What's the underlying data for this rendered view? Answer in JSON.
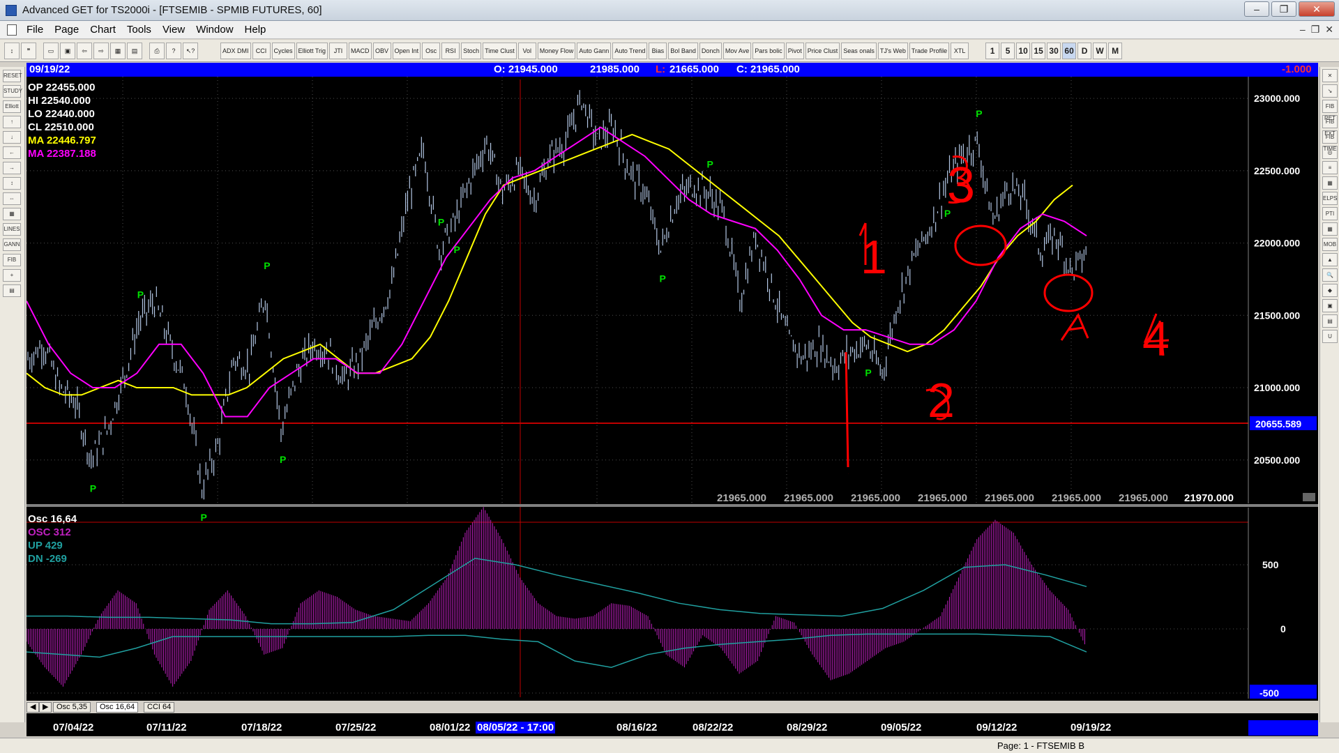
{
  "window": {
    "title": "Advanced GET for TS2000i - [FTSEMIB - SPMIB FUTURES, 60]",
    "minimize": "–",
    "maximize": "❐",
    "close": "✕"
  },
  "menu": [
    "File",
    "Page",
    "Chart",
    "Tools",
    "View",
    "Window",
    "Help"
  ],
  "toolbar": {
    "studies": [
      "ADX DMI",
      "CCI",
      "Cycles",
      "Elliott Trig",
      "JTI",
      "MACD",
      "OBV",
      "Open Int",
      "Osc",
      "RSI",
      "Stoch",
      "Time Clust",
      "Vol",
      "Money Flow",
      "Auto Gann",
      "Auto Trend",
      "Bias",
      "Bol Band",
      "Donch",
      "Mov Ave",
      "Pars bolic",
      "Pivot",
      "Price Clust",
      "Seas onals",
      "TJ's Web",
      "Trade Profile",
      "XTL"
    ],
    "intervals": [
      "1",
      "5",
      "10",
      "15",
      "30",
      "60",
      "D",
      "W",
      "M"
    ],
    "active_interval": "60"
  },
  "left_tools": [
    "RESET",
    "STUDY",
    "Elliott",
    "↑",
    "↓",
    "←",
    "→",
    "↕",
    "⇔",
    "▦",
    "LINES",
    "GANN",
    "FIB",
    "+",
    "▤"
  ],
  "right_tools": [
    "✕",
    "↘",
    "FIB RET",
    "FIB EXT",
    "FIB TIME",
    "◎",
    "≡",
    "▦",
    "ELPS",
    "PTI",
    "▦",
    "MOB",
    "▲",
    "🔍",
    "◆",
    "▣",
    "▤",
    "U"
  ],
  "infobar": {
    "date": "09/19/22",
    "open": "O: 21945.000",
    "high": "21985.000",
    "low_label": "L:",
    "low": "21665.000",
    "close": "C: 21965.000",
    "change": "-1.000"
  },
  "readout": {
    "op": "OP  22455.000",
    "hi": "HI   22540.000",
    "lo": "LO   22440.000",
    "cl": "CL   22510.000",
    "ma1": "MA  22446.797",
    "ma2": "MA  22387.188"
  },
  "price_axis": {
    "labels": [
      "23000.000",
      "22500.000",
      "22000.000",
      "21500.000",
      "21000.000",
      "20500.000"
    ],
    "cursor_price": "20655.589",
    "last_price": "21970.000"
  },
  "bottom_row_values": [
    "21965.000",
    "21965.000",
    "21965.000",
    "21965.000",
    "21965.000",
    "21965.000",
    "21965.000"
  ],
  "osc_readout": {
    "title": "Osc 16,64",
    "osc": "OSC 312",
    "up": "UP   429",
    "dn": "DN   -269"
  },
  "osc_axis": {
    "labels": [
      "500",
      "0",
      "-500"
    ]
  },
  "tabs": [
    "Osc 5,35",
    "Osc 16,64",
    "CCI 64"
  ],
  "active_tab": "Osc 16,64",
  "dates": [
    "07/04/22",
    "07/11/22",
    "07/18/22",
    "07/25/22",
    "08/01/22",
    "08/16/22",
    "08/22/22",
    "08/29/22",
    "09/05/22",
    "09/12/22",
    "09/19/22"
  ],
  "cursor_date": "08/05/22 - 17:00",
  "pivot_label": "P",
  "annotations": [
    "1",
    "1",
    "2",
    "3",
    "A",
    "4"
  ],
  "status": {
    "page": "Page: 1 - FTSEMIB B"
  },
  "colors": {
    "background": "#000000",
    "bar": "#b4c8e6",
    "ma_fast": "#ffff00",
    "ma_slow": "#ff00ff",
    "pivot": "#00e000",
    "annotation": "#ff0000",
    "osc": "#c020c0",
    "osc_band": "#20a0a0",
    "infobar": "#0000ff"
  },
  "chart_data": {
    "type": "line",
    "title": "FTSEMIB - SPMIB FUTURES, 60",
    "ylim": [
      20200,
      23150
    ],
    "series": [
      {
        "name": "price",
        "values": [
          21200,
          21300,
          21000,
          20900,
          20500,
          20700,
          21050,
          21450,
          21600,
          21300,
          21000,
          20300,
          20600,
          21200,
          21150,
          21650,
          20700,
          21100,
          21300,
          21250,
          21050,
          21200,
          21450,
          21700,
          22300,
          22650,
          21950,
          22150,
          22450,
          22700,
          22350,
          22500,
          22300,
          22600,
          22700,
          23000,
          22700,
          22800,
          22500,
          22350,
          21950,
          22300,
          22400,
          22350,
          22200,
          21600,
          22050,
          21700,
          21350,
          21200,
          21300,
          21150,
          21250,
          21300,
          21100,
          21600,
          21900,
          22100,
          22400,
          22600,
          22700,
          22150,
          22400,
          22300,
          21950,
          22050,
          21800,
          21950
        ]
      },
      {
        "name": "MA 22446.797",
        "values": [
          21100,
          21000,
          20950,
          20950,
          21000,
          21050,
          21000,
          21000,
          21000,
          20950,
          20950,
          20950,
          21000,
          21100,
          21200,
          21250,
          21300,
          21200,
          21100,
          21100,
          21150,
          21200,
          21350,
          21600,
          21900,
          22200,
          22400,
          22450,
          22500,
          22550,
          22600,
          22650,
          22700,
          22750,
          22700,
          22650,
          22550,
          22450,
          22350,
          22250,
          22150,
          22050,
          21900,
          21750,
          21600,
          21450,
          21350,
          21300,
          21250,
          21300,
          21400,
          21550,
          21700,
          21900,
          22050,
          22150,
          22300,
          22400
        ]
      },
      {
        "name": "MA 22387.188",
        "values": [
          21600,
          21300,
          21100,
          21000,
          21000,
          21100,
          21300,
          21300,
          21100,
          20800,
          20800,
          21000,
          21100,
          21200,
          21200,
          21100,
          21100,
          21300,
          21600,
          21900,
          22100,
          22300,
          22450,
          22500,
          22600,
          22700,
          22800,
          22700,
          22600,
          22450,
          22300,
          22200,
          22150,
          22100,
          21950,
          21750,
          21500,
          21400,
          21400,
          21350,
          21300,
          21300,
          21400,
          21600,
          21900,
          22100,
          22200,
          22150,
          22050
        ]
      },
      {
        "name": "OSC 312",
        "values": [
          -100,
          -300,
          -450,
          -200,
          100,
          300,
          200,
          -200,
          -450,
          -250,
          150,
          300,
          100,
          -200,
          -150,
          200,
          300,
          250,
          150,
          100,
          80,
          60,
          200,
          400,
          750,
          950,
          700,
          400,
          200,
          100,
          80,
          100,
          200,
          180,
          100,
          -200,
          -300,
          -50,
          -150,
          -350,
          -250,
          100,
          50,
          -200,
          -400,
          -350,
          -250,
          -150,
          -100,
          0,
          100,
          400,
          700,
          850,
          750,
          500,
          300,
          150,
          -150
        ]
      },
      {
        "name": "UP 429",
        "values": [
          100,
          100,
          90,
          90,
          80,
          70,
          40,
          40,
          50,
          150,
          350,
          550,
          500,
          420,
          350,
          280,
          200,
          150,
          120,
          110,
          100,
          160,
          300,
          480,
          500,
          420,
          330
        ]
      },
      {
        "name": "DN -269",
        "values": [
          -180,
          -200,
          -220,
          -150,
          -60,
          -60,
          -60,
          -60,
          -60,
          -60,
          -60,
          -50,
          -50,
          -80,
          -100,
          -250,
          -300,
          -200,
          -150,
          -120,
          -100,
          -80,
          -50,
          -40,
          -40,
          -40,
          -40,
          -50,
          -60,
          -180
        ]
      }
    ]
  }
}
